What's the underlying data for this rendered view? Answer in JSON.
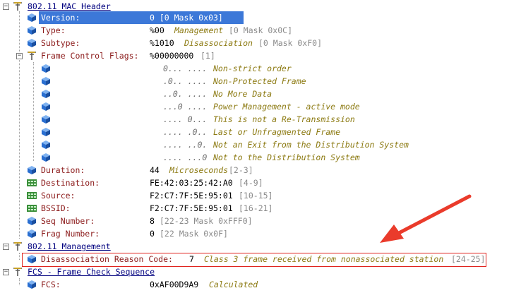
{
  "colors": {
    "selection": "#3c78d8",
    "highlight": "#e0231e",
    "arrow": "#ea3b2b"
  },
  "mac_header": {
    "title": "802.11 MAC Header",
    "version": {
      "name": "Version:",
      "value": "0 [0 Mask 0x03]"
    },
    "type": {
      "name": "Type:",
      "value": "%00",
      "desc": "Management",
      "range": "[0 Mask 0x0C]"
    },
    "subtype": {
      "name": "Subtype:",
      "value": "%1010",
      "desc": "Disassociation",
      "range": "[0 Mask 0xF0]"
    },
    "fcf": {
      "name": "Frame Control Flags:",
      "value": "%00000000",
      "range": "[1]",
      "flags": [
        {
          "bits": "0... ....",
          "text": "Non-strict order"
        },
        {
          "bits": ".0.. ....",
          "text": "Non-Protected Frame"
        },
        {
          "bits": "..0. ....",
          "text": "No More Data"
        },
        {
          "bits": "...0 ....",
          "text": "Power Management - active mode"
        },
        {
          "bits": ".... 0...",
          "text": "This is not a Re-Transmission"
        },
        {
          "bits": ".... .0..",
          "text": "Last or Unfragmented Frame"
        },
        {
          "bits": ".... ..0.",
          "text": "Not an Exit from the Distribution System"
        },
        {
          "bits": ".... ...0",
          "text": "Not to the Distribution System"
        }
      ]
    },
    "duration": {
      "name": "Duration:",
      "value": "44",
      "desc": "Microseconds",
      "range": "[2-3]"
    },
    "destination": {
      "name": "Destination:",
      "value": "FE:42:03:25:42:A0",
      "range": "[4-9]"
    },
    "source": {
      "name": "Source:",
      "value": "F2:C7:7F:5E:95:01",
      "range": "[10-15]"
    },
    "bssid": {
      "name": "BSSID:",
      "value": "F2:C7:7F:5E:95:01",
      "range": "[16-21]"
    },
    "seq": {
      "name": "Seq Number:",
      "value": "8",
      "range": "[22-23 Mask 0xFFF0]"
    },
    "frag": {
      "name": "Frag Number:",
      "value": "0",
      "range": "[22 Mask 0x0F]"
    }
  },
  "management": {
    "title": "802.11 Management",
    "reason": {
      "name": "Disassociation Reason Code:",
      "value": "7",
      "desc": "Class 3 frame received from nonassociated station",
      "range": "[24-25]"
    }
  },
  "fcs_section": {
    "title": "FCS - Frame Check Sequence",
    "fcs": {
      "name": "FCS:",
      "value": "0xAF00D9A9",
      "desc": "Calculated"
    }
  },
  "icons": {
    "section": "branch-icon",
    "field": "cube-icon",
    "address": "network-address-icon"
  }
}
